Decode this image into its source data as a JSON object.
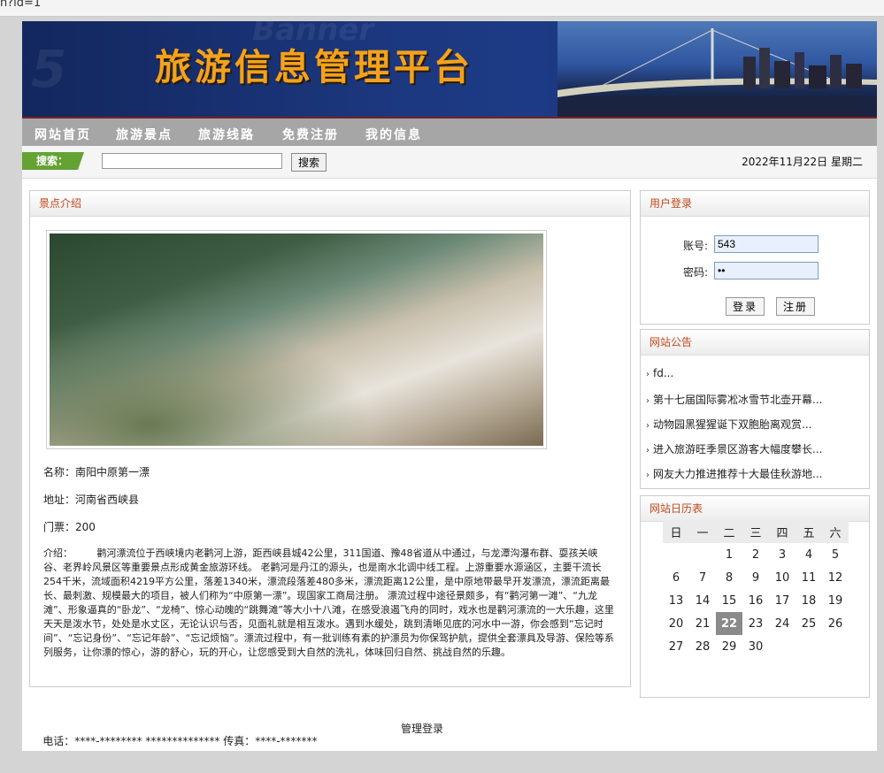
{
  "url_fragment": "n?id=1",
  "banner": {
    "title": "旅游信息管理平台"
  },
  "nav": [
    "网站首页",
    "旅游景点",
    "旅游线路",
    "免费注册",
    "我的信息"
  ],
  "search": {
    "label": "搜索：",
    "value": "",
    "button": "搜索"
  },
  "date": "2022年11月22日 星期二",
  "scenic": {
    "header": "景点介绍",
    "name_line": "名称：南阳中原第一漂",
    "address_line": "地址：河南省西峡县",
    "ticket_line": "门票：200",
    "intro": "介绍：　　　鹳河漂流位于西峡境内老鹳河上游，距西峡县城42公里，311国道、豫48省道从中通过，与龙潭沟瀑布群、耍孩关峡谷、老界岭风景区等重要景点形成黄金旅游环线。 老鹳河是丹江的源头，也是南水北调中线工程。上游重要水源涵区，主要干流长254千米，流域面积4219平方公里，落差1340米，漂流段落差480多米，漂流距离12公里，是中原地带最早开发漂流，漂流距离最长、最刺激、规模最大的项目，被人们称为“中原第一漂”。现国家工商局注册。 漂流过程中途径景颇多，有“鹳河第一滩”、“九龙滩”、形象逼真的“卧龙”、“龙椅”、惊心动魄的“跳舞滩”等大小十八滩，在感受浪遏飞舟的同时，戏水也是鹳河漂流的一大乐趣，这里天天是泼水节，处处是水丈区，无论认识与否，见面礼就是相互泼水。遇到水缓处，跳到清晰见底的河水中一游，你会感到“忘记时间”、“忘记身份”、“忘记年龄”、“忘记烦恼”。漂流过程中，有一批训练有素的护漂员为你保驾护航，提供全套漂具及导游、保险等系列服务，让你漂的惊心，游的舒心，玩的开心，让您感受到大自然的洗礼，体味回归自然、挑战自然的乐趣。"
  },
  "login": {
    "header": "用户登录",
    "account_label": "账号:",
    "account_value": "543",
    "password_label": "密码:",
    "password_value": "••",
    "login_button": "登录",
    "register_button": "注册"
  },
  "notices": {
    "header": "网站公告",
    "items": [
      "fd...",
      "第十七届国际雾凇冰雪节北壶开幕...",
      "动物园黑猩猩诞下双胞胎离观赏...",
      "进入旅游旺季景区游客大幅度攀长...",
      "网友大力推进推荐十大最佳秋游地..."
    ]
  },
  "calendar": {
    "header": "网站日历表",
    "weekdays": [
      "日",
      "一",
      "二",
      "三",
      "四",
      "五",
      "六"
    ],
    "weeks": [
      [
        "",
        "",
        "1",
        "2",
        "3",
        "4",
        "5"
      ],
      [
        "6",
        "7",
        "8",
        "9",
        "10",
        "11",
        "12"
      ],
      [
        "13",
        "14",
        "15",
        "16",
        "17",
        "18",
        "19"
      ],
      [
        "20",
        "21",
        "22",
        "23",
        "24",
        "25",
        "26"
      ],
      [
        "27",
        "28",
        "29",
        "30",
        "",
        "",
        ""
      ]
    ],
    "today": "22"
  },
  "footer": {
    "text": "电话：****-******** ************** 传真：****-*******",
    "admin_link": "管理登录"
  },
  "colors": {
    "accent": "#c0481a",
    "nav_bg": "#a6a6a6",
    "banner_title": "#f4a21c",
    "search_label_bg": "#64a233"
  }
}
